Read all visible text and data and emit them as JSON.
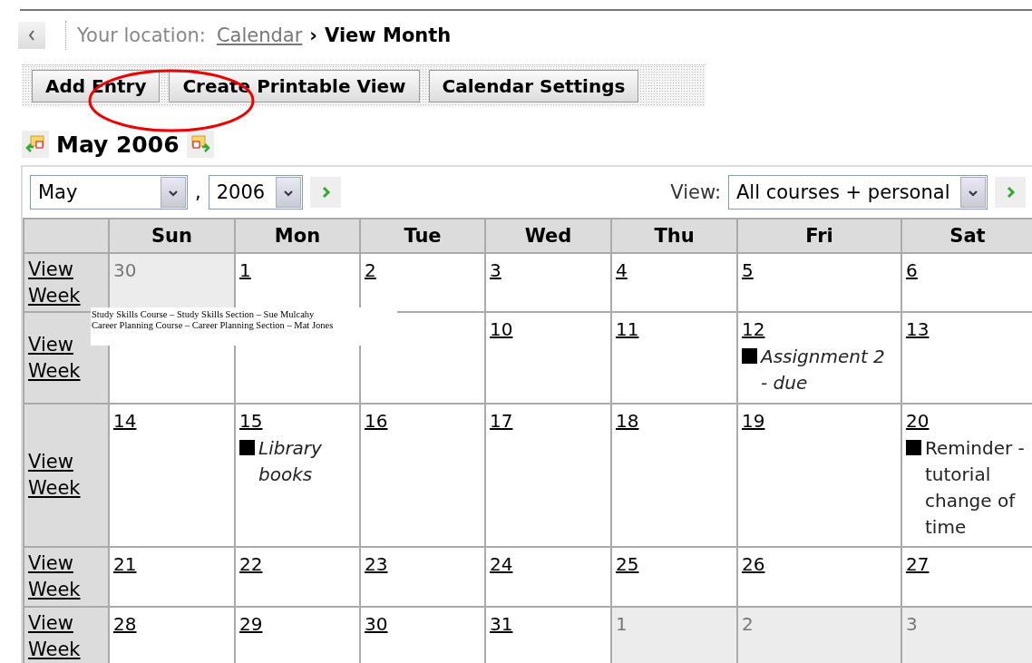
{
  "breadcrumb": {
    "prefix": "Your location:",
    "link": "Calendar",
    "separator": "›",
    "current": "View Month"
  },
  "toolbar": {
    "buttons": [
      "Add Entry",
      "Create Printable View",
      "Calendar Settings"
    ]
  },
  "title": "May 2006",
  "controls": {
    "month": "May",
    "comma": ",",
    "year": "2006",
    "view_label": "View:",
    "view": "All courses + personal"
  },
  "table": {
    "columns": [
      "Sun",
      "Mon",
      "Tue",
      "Wed",
      "Thu",
      "Fri",
      "Sat"
    ],
    "rows": [
      {
        "week_link": "View Week",
        "days": [
          {
            "day": "30",
            "in_month": false
          },
          {
            "day": "1",
            "in_month": true
          },
          {
            "day": "2",
            "in_month": true
          },
          {
            "day": "3",
            "in_month": true
          },
          {
            "day": "4",
            "in_month": true
          },
          {
            "day": "5",
            "in_month": true
          },
          {
            "day": "6",
            "in_month": true
          }
        ]
      },
      {
        "week_link": "View Week",
        "days": [
          {
            "in_month": true
          },
          {
            "in_month": true
          },
          {
            "in_month": true
          },
          {
            "day": "10",
            "in_month": true
          },
          {
            "day": "11",
            "in_month": true
          },
          {
            "day": "12",
            "in_month": true,
            "events": [
              {
                "text": "Assignment 2 - due",
                "italic": true
              }
            ]
          },
          {
            "day": "13",
            "in_month": true
          }
        ]
      },
      {
        "week_link": "View Week",
        "days": [
          {
            "day": "14",
            "in_month": true
          },
          {
            "day": "15",
            "in_month": true,
            "events": [
              {
                "text": "Library books",
                "italic": true
              }
            ]
          },
          {
            "day": "16",
            "in_month": true
          },
          {
            "day": "17",
            "in_month": true
          },
          {
            "day": "18",
            "in_month": true
          },
          {
            "day": "19",
            "in_month": true
          },
          {
            "day": "20",
            "in_month": true,
            "events": [
              {
                "text": "Reminder - tutorial change of time",
                "italic": false
              }
            ]
          }
        ]
      },
      {
        "week_link": "View Week",
        "days": [
          {
            "day": "21",
            "in_month": true
          },
          {
            "day": "22",
            "in_month": true
          },
          {
            "day": "23",
            "in_month": true
          },
          {
            "day": "24",
            "in_month": true
          },
          {
            "day": "25",
            "in_month": true
          },
          {
            "day": "26",
            "in_month": true
          },
          {
            "day": "27",
            "in_month": true
          }
        ]
      },
      {
        "week_link": "View Week",
        "days": [
          {
            "day": "28",
            "in_month": true
          },
          {
            "day": "29",
            "in_month": true
          },
          {
            "day": "30",
            "in_month": true
          },
          {
            "day": "31",
            "in_month": true
          },
          {
            "day": "1",
            "in_month": false
          },
          {
            "day": "2",
            "in_month": false
          },
          {
            "day": "3",
            "in_month": false
          }
        ]
      }
    ]
  },
  "tooltip": {
    "lines": [
      "Study Skills Course – Study Skills Section – Sue Mulcahy",
      "Career Planning Course – Career Planning Section – Mat Jones"
    ]
  }
}
